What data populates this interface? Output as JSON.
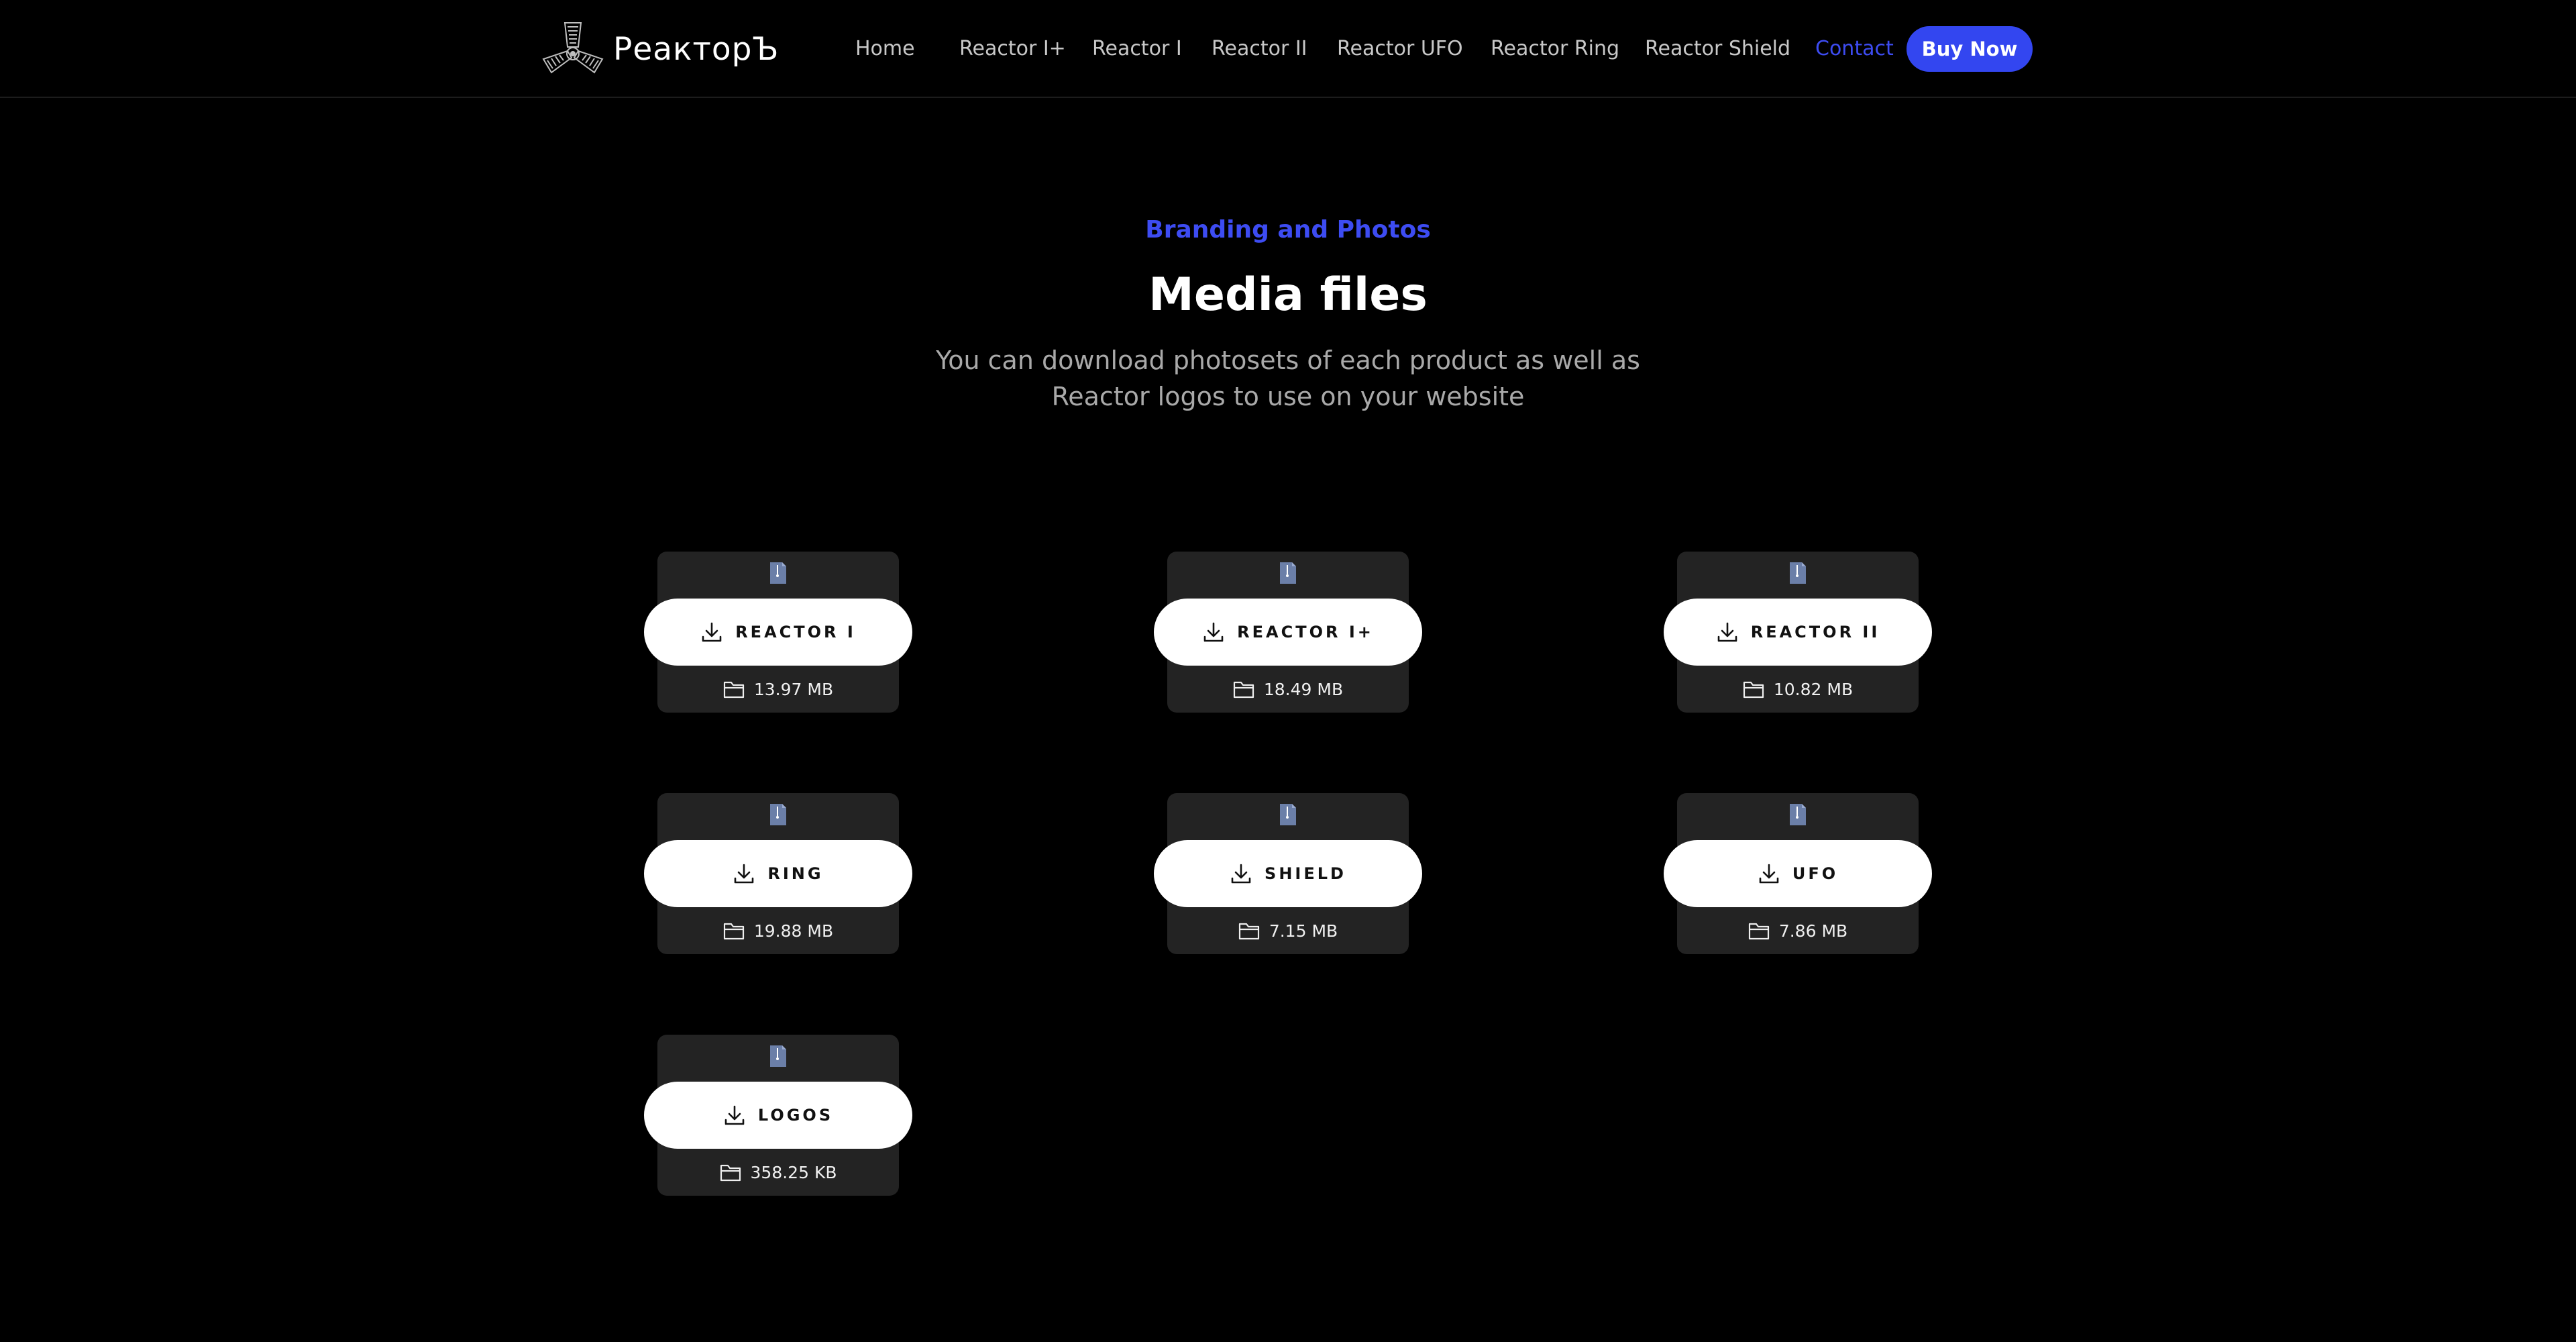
{
  "brand": {
    "name": "РеакторЪ",
    "logo_icon": "reactor-logo-icon"
  },
  "nav": {
    "items": [
      {
        "label": "Home",
        "active": false
      },
      {
        "label": "Reactor I+",
        "active": false
      },
      {
        "label": "Reactor I",
        "active": false
      },
      {
        "label": "Reactor II",
        "active": false
      },
      {
        "label": "Reactor UFO",
        "active": false
      },
      {
        "label": "Reactor Ring",
        "active": false
      },
      {
        "label": "Reactor Shield",
        "active": false
      },
      {
        "label": "Contact",
        "active": true
      }
    ],
    "buy_label": "Buy Now"
  },
  "hero": {
    "eyebrow": "Branding and Photos",
    "title": "Media files",
    "subtitle": "You can download photosets of each product as well as Reactor logos to use on your website"
  },
  "files": [
    {
      "label": "REACTOR I",
      "size": "13.97 MB"
    },
    {
      "label": "REACTOR I+",
      "size": "18.49 MB"
    },
    {
      "label": "REACTOR II",
      "size": "10.82 MB"
    },
    {
      "label": "RING",
      "size": "19.88 MB"
    },
    {
      "label": "SHIELD",
      "size": "7.15 MB"
    },
    {
      "label": "UFO",
      "size": "7.86 MB"
    },
    {
      "label": "LOGOS",
      "size": "358.25 KB"
    }
  ],
  "icons": {
    "file": "zip-file-icon",
    "download": "download-icon",
    "folder": "folder-icon"
  },
  "colors": {
    "background": "#000000",
    "accent": "#3346f0",
    "card": "#232323",
    "muted_text": "#a9a9a9",
    "file_icon": "#6b7fa8"
  }
}
